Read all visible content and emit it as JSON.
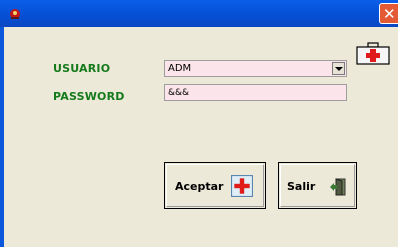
{
  "window": {
    "title": "",
    "close_glyph": "✕"
  },
  "form": {
    "usuario_label": "USUARIO",
    "usuario_value": "ADM",
    "password_label": "PASSWORD",
    "password_value": "&&&"
  },
  "buttons": {
    "accept_label": "Aceptar",
    "exit_label": "Salir"
  },
  "icons": {
    "app": "app-logo-icon",
    "medkit": "first-aid-kit-icon",
    "accept": "red-cross-icon",
    "exit": "exit-door-icon"
  },
  "colors": {
    "titlebar": "#0650d6",
    "label_green": "#157a1b",
    "field_bg": "#fbe4ea",
    "close_red": "#e35a34"
  }
}
